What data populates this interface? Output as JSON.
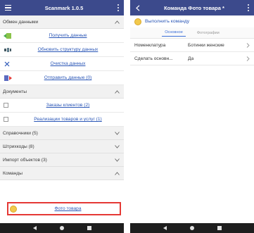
{
  "left": {
    "appbar": {
      "title": "Scanmark 1.0.5",
      "menu_icon": "hamburger-icon",
      "more_icon": "more-vert-icon"
    },
    "sections": {
      "exchange": {
        "label": "Обмен данными",
        "expanded": true
      },
      "documents": {
        "label": "Документы",
        "expanded": true
      },
      "catalogs": {
        "label": "Справочники (5)",
        "expanded": false
      },
      "barcodes": {
        "label": "Штрихкоды (8)",
        "expanded": false
      },
      "import": {
        "label": "Импорт объектов (3)",
        "expanded": false
      },
      "commands": {
        "label": "Команды",
        "expanded": true
      }
    },
    "exchange_items": [
      {
        "label": "Получить данные",
        "icon": "download-icon"
      },
      {
        "label": "Обновить структуру данных",
        "icon": "structure-icon"
      },
      {
        "label": "Очистка данных",
        "icon": "close-icon"
      },
      {
        "label": "Отправить данные (0)",
        "icon": "upload-icon"
      }
    ],
    "document_items": [
      {
        "label": "Заказы клиентов (2)"
      },
      {
        "label": "Реализации товаров и услуг (1)"
      }
    ],
    "command_item": {
      "label": "Фото товара",
      "icon": "coin-icon"
    }
  },
  "right": {
    "appbar": {
      "title": "Команда Фото товара *",
      "back_icon": "back-arrow-icon",
      "more_icon": "more-vert-icon"
    },
    "execute_label": "Выполнить команду",
    "tabs": [
      {
        "label": "Основное",
        "active": true
      },
      {
        "label": "Фотографии",
        "active": false
      }
    ],
    "props": [
      {
        "key": "Номенклатура",
        "value": "Ботинки женские"
      },
      {
        "key": "Сделать основн...",
        "value": "Да"
      }
    ]
  },
  "colors": {
    "appbar": "#3c4a8c",
    "link": "#2b57b7",
    "highlight_border": "#e53935",
    "navbar": "#1e1e1e"
  }
}
